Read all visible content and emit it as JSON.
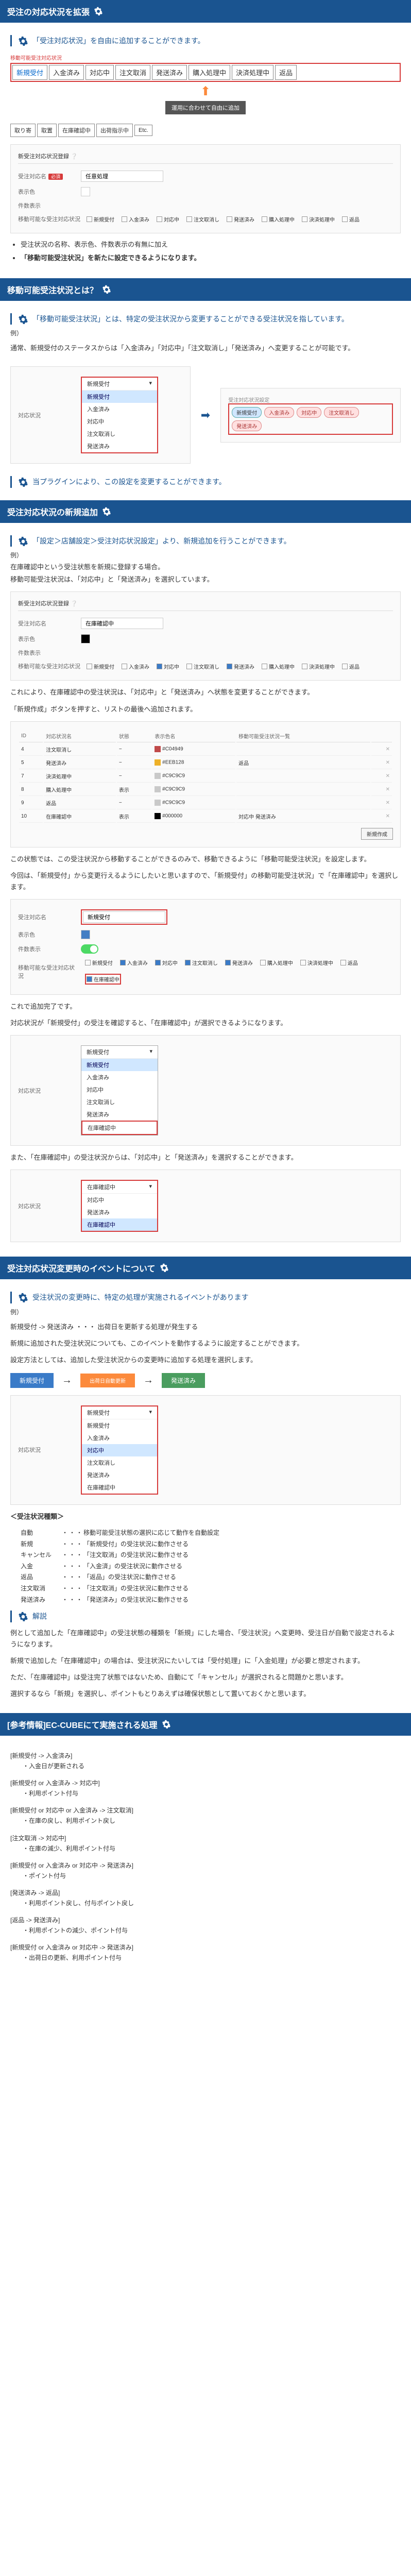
{
  "sections": {
    "s1": {
      "title": "受注の対応状況を拡張",
      "quote": "「受注対応状況」を自由に追加することができます。",
      "group_label": "移動可能受注対応状況",
      "preset_statuses": [
        "新規受付",
        "入金済み",
        "対応中",
        "注文取消",
        "発送済み",
        "購入処理中",
        "決済処理中",
        "返品"
      ],
      "arrow_label": "運用に合わせて自由に追加",
      "extra_statuses": [
        "取り寄",
        "取置",
        "在庫確認中",
        "出荷指示中",
        "Etc."
      ],
      "bullets": [
        "受注状況の名称、表示色、件数表示の有無に加え",
        "「移動可能受注状況」を新たに設定できるようになります。"
      ],
      "form": {
        "title": "新受注対応状況登録",
        "name_label": "受注対応名",
        "name_required": "必須",
        "name_value": "任意処理",
        "color_label": "表示色",
        "count_label": "件数表示",
        "movable_label": "移動可能な受注対応状況",
        "movable_options": [
          "新規受付",
          "入金済み",
          "対応中",
          "注文取消し",
          "発送済み",
          "購入処理中",
          "決済処理中",
          "返品"
        ]
      }
    },
    "s2": {
      "title": "移動可能受注状況とは？",
      "quote": "「移動可能受注状況」とは、特定の受注状況から変更することができる受注状況を指しています。",
      "example_label": "例）",
      "example_text": "通常、新規受付のステータスからは「入金済み」「対応中」「注文取消し」「発送済み」へ変更することが可能です。",
      "dropdown_label": "対応状況",
      "dropdown_selected": "新規受付",
      "dropdown_items": [
        "新規受付",
        "入金済み",
        "対応中",
        "注文取消し",
        "発送済み"
      ],
      "pill_label": "受注対応状況設定",
      "pills": [
        "新規受付",
        "入金済み",
        "対応中",
        "注文取消し",
        "発送済み"
      ],
      "footer_quote": "当プラグインにより、この設定を変更することができます。"
    },
    "s3": {
      "title": "受注対応状況の新規追加",
      "quote": "「設定＞店舗設定＞受注対応状況設定」より、新規追加を行うことができます。",
      "example_label": "例）",
      "ex1": "在庫確認中という受注状態を新規に登録する場合。",
      "ex2": "移動可能受注状況は、「対応中」と「発送済み」を選択しています。",
      "form": {
        "title_label": "新受注対応状況登録",
        "name_label": "受注対応名",
        "name_value": "在庫確認中",
        "color_label": "表示色",
        "count_label": "件数表示",
        "movable_label": "移動可能な受注対応状況",
        "checked": [
          "対応中",
          "発送済み"
        ],
        "all": [
          "新規受付",
          "入金済み",
          "対応中",
          "注文取消し",
          "発送済み",
          "購入処理中",
          "決済処理中",
          "返品"
        ]
      },
      "para1": "これにより、在庫確認中の受注状況は、「対応中」と「発送済み」へ状態を変更することができます。",
      "para2": "「新規作成」ボタンを押すと、リストの最後へ追加されます。",
      "table": {
        "headers": [
          "ID",
          "対応状況名",
          "状態",
          "表示色名",
          "移動可能受注状況一覧",
          ""
        ],
        "rows": [
          {
            "id": "4",
            "name": "注文取消し",
            "state": "−",
            "color": "#C04949",
            "movable": ""
          },
          {
            "id": "5",
            "name": "発送済み",
            "state": "−",
            "color": "#EEB128",
            "movable": "返品"
          },
          {
            "id": "7",
            "name": "決済処理中",
            "state": "−",
            "color": "#C9C9C9",
            "movable": ""
          },
          {
            "id": "8",
            "name": "購入処理中",
            "state": "表示",
            "color": "#C9C9C9",
            "movable": ""
          },
          {
            "id": "9",
            "name": "返品",
            "state": "−",
            "color": "#C9C9C9",
            "movable": ""
          },
          {
            "id": "10",
            "name": "在庫確認中",
            "state": "表示",
            "color": "#000000",
            "movable": "対応中 発送済み",
            "highlight": true
          }
        ],
        "new_btn": "新規作成"
      },
      "para3": "この状態では、この受注状況から移動することができるのみで、移動できるように「移動可能受注状況」を設定します。",
      "para4": "今回は、「新規受付」から変更行えるようにしたいと思いますので、「新規受付」の移動可能受注状況」で「在庫確認中」を選択します。",
      "form2": {
        "name_label": "受注対応名",
        "name_value": "新規受付",
        "color_label": "表示色",
        "count_label": "件数表示",
        "movable_label": "移動可能な受注対応状況",
        "checked": [
          "入金済み",
          "対応中",
          "注文取消し",
          "発送済み",
          "在庫確認中"
        ]
      },
      "para5": "これで追加完了です。",
      "para6": "対応状況が「新規受付」の受注を確認すると、「在庫確認中」が選択できるようになります。",
      "dropdown2_label": "対応状況",
      "dropdown2_selected": "新規受付",
      "dropdown2_items": [
        "新規受付",
        "入金済み",
        "対応中",
        "注文取消し",
        "発送済み",
        "在庫確認中"
      ],
      "para7": "また、「在庫確認中」の受注状況からは、「対応中」と「発送済み」を選択することができます。",
      "dropdown3_label": "対応状況",
      "dropdown3_selected": "在庫確認中",
      "dropdown3_items": [
        "対応中",
        "発送済み",
        "在庫確認中"
      ]
    },
    "s4": {
      "title": "受注対応状況変更時のイベントについて",
      "quote": "受注状況の変更時に、特定の処理が実施されるイベントがあります",
      "example_label": "例）",
      "ex1": "新規受付 -> 発送済み ・・・ 出荷日を更新する処理が発生する",
      "para1": "新規に追加された受注状況についても、このイベントを動作するように設定することができます。",
      "para2": "設定方法としては、追加した受注状況からの変更時に追加する処理を選択します。",
      "flow": {
        "from": "新規受付",
        "event": "出荷日自動更新",
        "to": "発送済み"
      },
      "dropdown4_label": "対応状況",
      "dropdown4_selected": "新規受付",
      "dropdown4_items": [
        "新規受付",
        "入金済み",
        "対応中",
        "注文取消し",
        "発送済み",
        "在庫確認中"
      ],
      "dropdown4_highlight": "対応中",
      "category_header": "＜受注状況種類＞",
      "categories": [
        {
          "key": "自動",
          "desc": "移動可能受注状態の選択に応じて動作を自動設定"
        },
        {
          "key": "新規",
          "desc": "「新規受付」の受注状況に動作させる"
        },
        {
          "key": "キャンセル",
          "desc": "「注文取消」の受注状況に動作させる"
        },
        {
          "key": "入金",
          "desc": "「入金済」の受注状況に動作させる"
        },
        {
          "key": "返品",
          "desc": "「返品」の受注状況に動作させる"
        },
        {
          "key": "注文取消",
          "desc": "「注文取消」の受注状況に動作させる"
        },
        {
          "key": "発送済み",
          "desc": "「発送済み」の受注状況に動作させる"
        }
      ],
      "explain_title": "解説",
      "explain1": "例として追加した「在庫確認中」の受注状態の種類を「新規」にした場合、「受注状況」へ変更時、受注日が自動で設定されるようになります。",
      "explain2": "新規で追加した「在庫確認中」の場合は、受注状況にたいしては「受付処理」に「入金処理」が必要と想定されます。",
      "explain3": "ただ、「在庫確認中」は受注完了状態ではないため、自動にて「キャンセル」が選択されると問題かと思います。",
      "explain4": "選択するなら「新規」を選択し、ポイントもとりあえずは確保状態として置いておくかと思います。"
    },
    "s5": {
      "title": "[参考情報]EC-CUBEにて実施される処理",
      "items": [
        {
          "transition": "[新規受付 -> 入金済み]",
          "actions": [
            "入金日が更新される"
          ]
        },
        {
          "transition": "[新規受付 or 入金済み -> 対応中]",
          "actions": [
            "利用ポイント付与"
          ]
        },
        {
          "transition": "[新規受付 or 対応中 or 入金済み -> 注文取消]",
          "actions": [
            "在庫の戻し、利用ポイント戻し"
          ]
        },
        {
          "transition": "[注文取消 -> 対応中]",
          "actions": [
            "在庫の減少、利用ポイント付与"
          ]
        },
        {
          "transition": "[新規受付 or 入金済み or 対応中 -> 発送済み]",
          "actions": [
            "ポイント付与"
          ]
        },
        {
          "transition": "[発送済み -> 返品]",
          "actions": [
            "利用ポイント戻し、付与ポイント戻し"
          ]
        },
        {
          "transition": "[返品 -> 発送済み]",
          "actions": [
            "利用ポイントの減少、ポイント付与"
          ]
        },
        {
          "transition": "[新規受付 or 入金済み or 対応中 -> 発送済み]",
          "actions": [
            "出荷日の更新、利用ポイント付与"
          ]
        }
      ]
    }
  }
}
